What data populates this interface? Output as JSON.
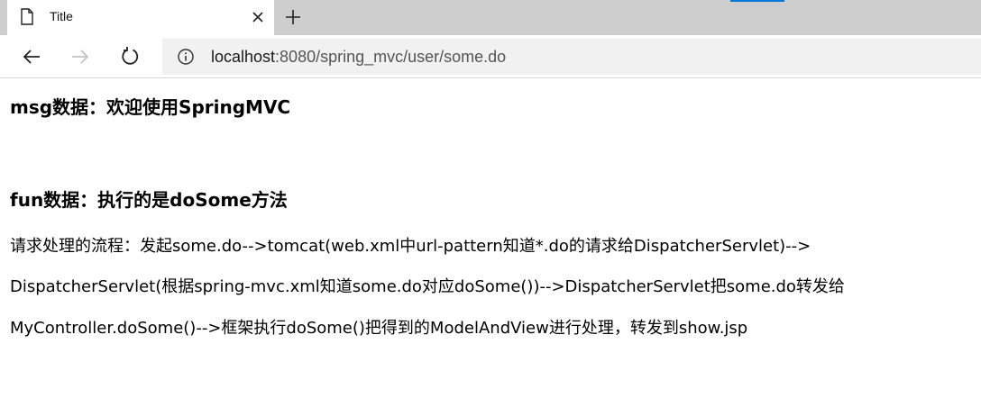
{
  "browser": {
    "tab_title": "Title",
    "url_host": "localhost",
    "url_rest": ":8080/spring_mvc/user/some.do"
  },
  "page": {
    "msg_heading": "msg数据：欢迎使用SpringMVC",
    "fun_heading": "fun数据：执行的是doSome方法",
    "lines": [
      "请求处理的流程：发起some.do-->tomcat(web.xml中url-pattern知道*.do的请求给DispatcherServlet)-->",
      "DispatcherServlet(根据spring-mvc.xml知道some.do对应doSome())-->DispatcherServlet把some.do转发给",
      "MyController.doSome()-->框架执行doSome()把得到的ModelAndView进行处理，转发到show.jsp"
    ]
  },
  "colors": {
    "tabstrip_bg": "#cecece",
    "accent": "#0078d7",
    "address_bg": "#f1f1f1"
  }
}
